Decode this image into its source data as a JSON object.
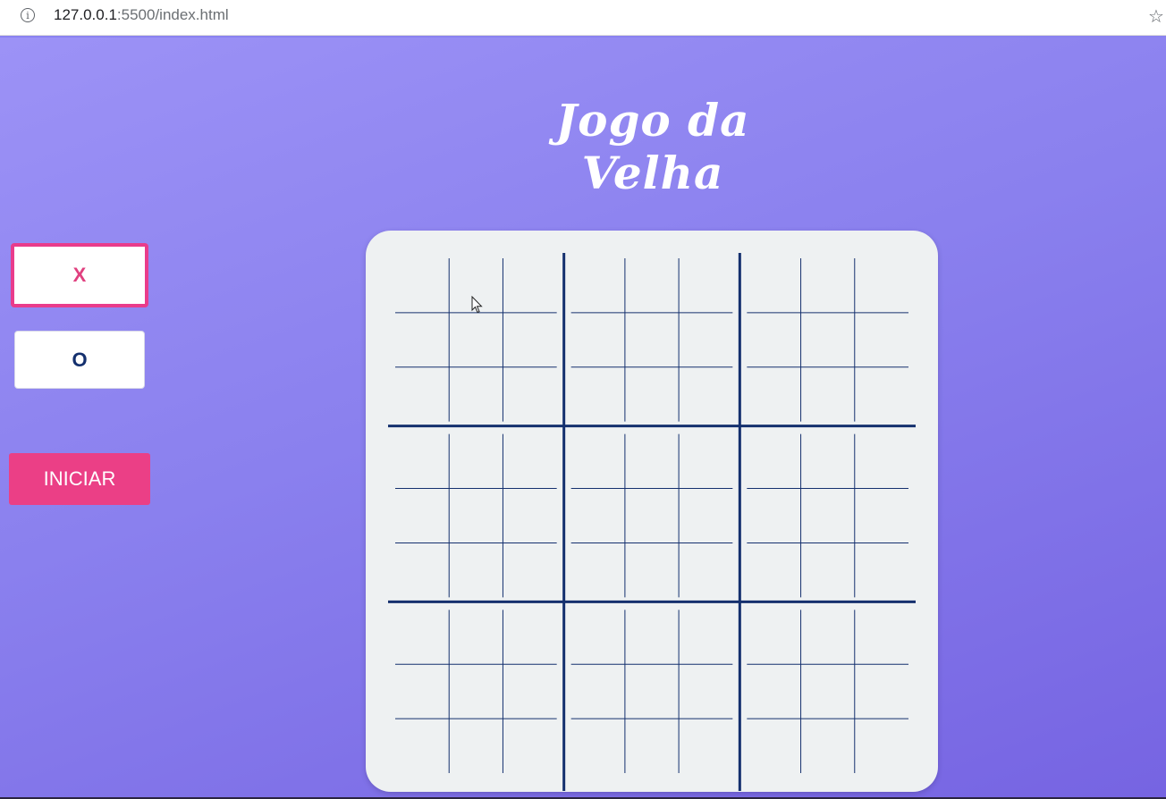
{
  "browser": {
    "url_host": "127.0.0.1",
    "url_rest": ":5500/index.html",
    "info_icon": "info-icon",
    "star_icon": "bookmark-star-icon"
  },
  "game": {
    "title": "Jogo da Velha",
    "choices": {
      "x_label": "X",
      "o_label": "O"
    },
    "start_label": "INICIAR",
    "board": {
      "big_grid": 3,
      "small_grid": 3
    }
  },
  "colors": {
    "background_top": "#9c92f6",
    "background_bottom": "#7664e2",
    "accent_pink": "#eb3f86",
    "grid_navy": "#14306e",
    "board_bg": "#eef1f2"
  }
}
